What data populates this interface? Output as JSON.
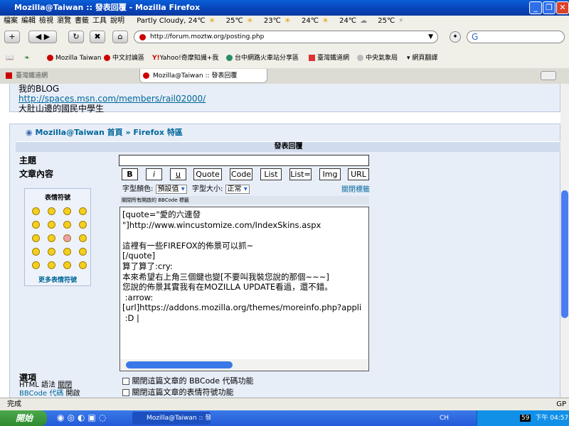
{
  "window": {
    "title": "Mozilla@Taiwan :: 發表回覆 - Mozilla Firefox",
    "min": "_",
    "max": "❐",
    "close": "✕"
  },
  "menu": [
    "檔案",
    "編輯",
    "檢視",
    "瀏覽",
    "書籤",
    "工具",
    "說明"
  ],
  "weather": [
    "Partly Cloudy, 24℃",
    "25℃",
    "23℃",
    "24℃",
    "24℃",
    "25℃"
  ],
  "nav": {
    "url": "http://forum.moztw.org/posting.php",
    "search_value": "G"
  },
  "bookmarks": [
    "Mozilla Taiwan",
    "中文討論區",
    "Yahoo!奇摩知識+我",
    "台中網路火車站分享區",
    "臺灣鐵道網",
    "中央氣象局",
    "網頁翻譯"
  ],
  "tabs": [
    {
      "label": "臺灣鐵道網"
    },
    {
      "label": "Mozilla@Taiwan :: 發表回覆"
    }
  ],
  "post": {
    "line1": "我的BLOG",
    "link": "http://spaces.msn.com/members/rail02000/",
    "line3": "大肚山邊的國民中學生"
  },
  "forum": {
    "home": "Mozilla@Taiwan 首頁",
    "sep": "»",
    "section": "Firefox 特區",
    "header": "發表回覆",
    "subject_label": "主題",
    "body_label": "文章內容",
    "subject_value": "",
    "bbcode_buttons": [
      "B",
      "i",
      "u",
      "Quote",
      "Code",
      "List",
      "List=",
      "Img",
      "URL"
    ],
    "font_color_label": "字型顏色:",
    "font_color_value": "預設值",
    "font_size_label": "字型大小:",
    "font_size_value": "正常",
    "close_tags": "關閉標籤",
    "hint": "關閉所有開啟的 BBCode 標籤",
    "smilies_title": "表情符號",
    "more_smilies": "更多表情符號",
    "body_text": "[quote=\"愛的六連發\n\"]http://www.wincustomize.com/IndexSkins.aspx\n\n這裡有一些FIREFOX的佈景可以抓~\n[/quote]\n算了算了:cry:\n本來希望右上角三個鍵也變[不要叫我裝您說的那個~~~]\n您說的佈景其實我有在MOZILLA UPDATE看過，還不錯。\n :arrow:\n[url]https://addons.mozilla.org/themes/moreinfo.php?appli\n :D |",
    "options_label": "選項",
    "html_label": "HTML 語法",
    "html_value": "關閉",
    "bbcode_label": "BBCode 代碼",
    "bbcode_value": "開啟",
    "opt1": "關閉這篇文章的 BBCode 代碼功能",
    "opt2": "關閉這篇文章的表情符號功能"
  },
  "status": {
    "text": "完成",
    "right": "GP"
  },
  "taskbar": {
    "start": "開始",
    "task": "Mozilla@Taiwan :: 發...",
    "lang": "CH",
    "clock": "下午 04:57",
    "badge": "59"
  }
}
